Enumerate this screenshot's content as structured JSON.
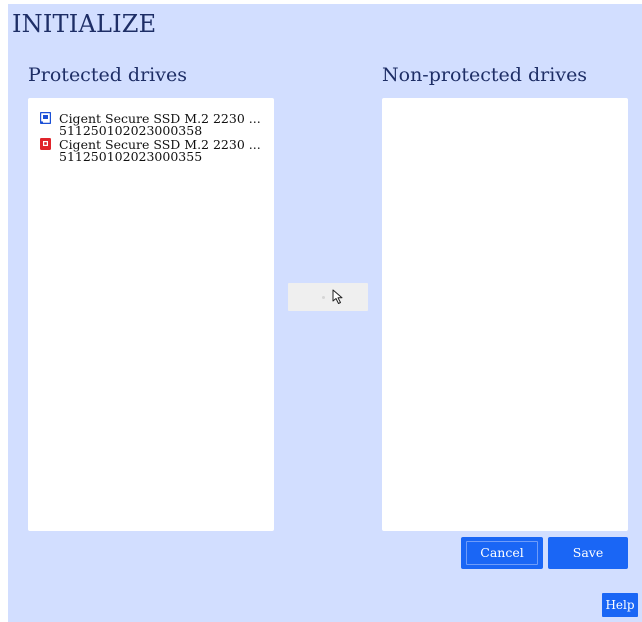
{
  "window": {
    "title": "INITIALIZE"
  },
  "protected": {
    "heading": "Protected drives",
    "drives": [
      {
        "name": "Cigent Secure SSD M.2 2230 ...",
        "serial": "511250102023000358",
        "icon": "drive-unlocked-icon",
        "icon_color": "#1a4fd6"
      },
      {
        "name": "Cigent Secure SSD M.2 2230 ...",
        "serial": "511250102023000355",
        "icon": "drive-locked-icon",
        "icon_color": "#e0242b"
      }
    ]
  },
  "non_protected": {
    "heading": "Non-protected drives",
    "drives": []
  },
  "actions": {
    "cancel_label": "Cancel",
    "save_label": "Save",
    "help_label": "Help"
  },
  "colors": {
    "background": "#d2deff",
    "accent": "#1a66f5",
    "heading_text": "#1e2e66"
  }
}
